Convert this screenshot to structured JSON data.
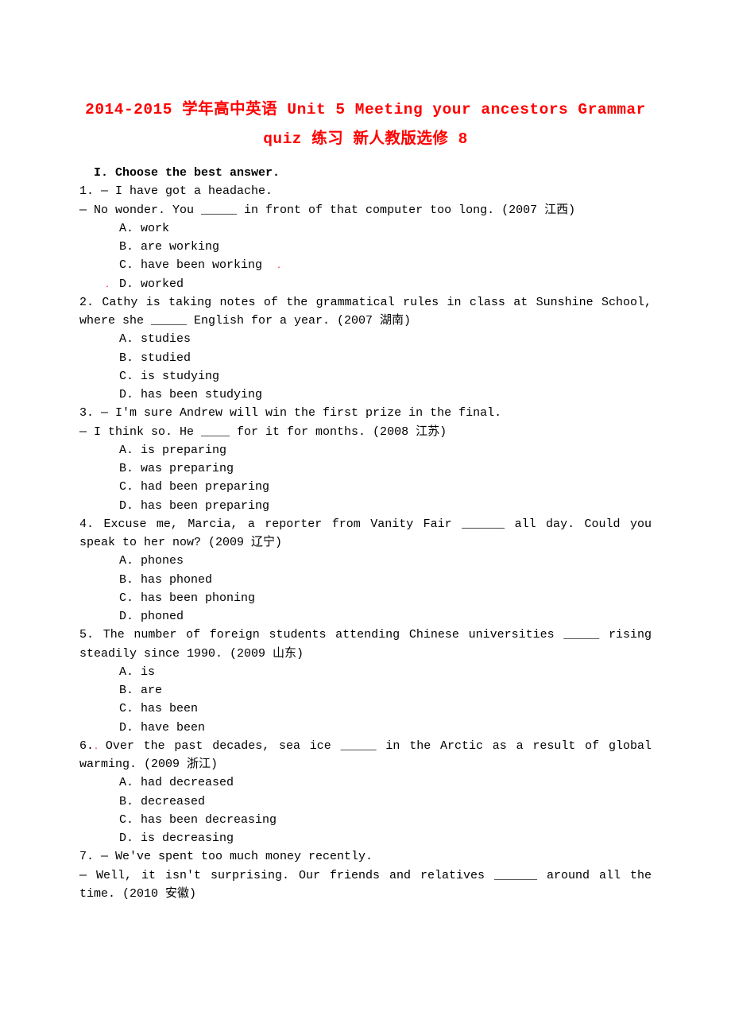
{
  "title_line1": "2014-2015 学年高中英语 Unit 5 Meeting your ancestors  Grammar",
  "title_line2": "quiz 练习 新人教版选修 8",
  "section_head": "I. Choose the best answer.",
  "q1": {
    "line1": "1. ― I have got a headache.",
    "line2": "― No wonder. You _____ in front of that computer too long. (2007 江西)",
    "A": "A. work",
    "B": "B. are working",
    "C": "C. have been working",
    "D": "D. worked"
  },
  "q2": {
    "line1": "2. Cathy is taking notes of the grammatical rules in class at Sunshine School, where she _____ English for a year. (2007 湖南)",
    "A": "A. studies",
    "B": "B. studied",
    "C": "C. is studying",
    "D": "D. has been studying"
  },
  "q3": {
    "line1": "3. ― I'm sure Andrew will win the first prize in the final.",
    "line2": "― I think so. He ____ for it for months. (2008 江苏)",
    "A": "A. is preparing",
    "B": "B. was preparing",
    "C": "C. had been preparing",
    "D": "D. has been preparing"
  },
  "q4": {
    "line1": "4. Excuse me, Marcia, a reporter from Vanity Fair ______ all day. Could you speak to her now? (2009 辽宁)",
    "A": "A. phones",
    "B": "B. has phoned",
    "C": "C. has been phoning",
    "D": "D. phoned"
  },
  "q5": {
    "line1": "5. The number of foreign students attending Chinese universities _____ rising steadily since 1990. (2009 山东)",
    "A": "A. is",
    "B": "B. are",
    "C": "C. has been",
    "D": "D. have been"
  },
  "q6": {
    "prefix": "6.",
    "rest": "Over the past decades, sea ice _____ in the Arctic as a result of global warming. (2009 浙江)",
    "A": " A. had decreased",
    "B": "B. decreased",
    "C": "C. has been decreasing",
    "D": "D. is decreasing"
  },
  "q7": {
    "line1": "7. ― We've spent too much money recently.",
    "line2": "― Well, it isn't surprising. Our friends and relatives ______ around all the time. (2010 安徽)"
  }
}
